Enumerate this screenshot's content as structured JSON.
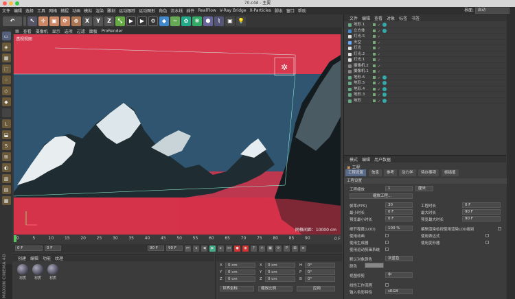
{
  "window": {
    "title": "70.c4d - 主要"
  },
  "menubar": {
    "items": [
      "文件",
      "编辑",
      "选择",
      "工具",
      "网格",
      "捕捉",
      "动画",
      "模拟",
      "渲染",
      "雕刻",
      "运动跟踪",
      "运动图形",
      "角色",
      "流水线",
      "插件",
      "RealFlow",
      "V-Ray Bridge",
      "X-Particles",
      "脚本",
      "窗口",
      "帮助"
    ],
    "layout_label": "界面:",
    "layout_value": "启动"
  },
  "toolbar": {
    "axis_x": "X",
    "axis_y": "Y",
    "axis_z": "Z"
  },
  "viewport": {
    "menu": [
      "查看",
      "摄像机",
      "显示",
      "选项",
      "过滤",
      "面板",
      "ProRender"
    ],
    "label": "透视视图",
    "grid_info": "网格间距：10000 cm"
  },
  "timeline": {
    "ticks": [
      "0",
      "5",
      "10",
      "15",
      "20",
      "25",
      "30",
      "35",
      "40",
      "45",
      "50",
      "55",
      "60",
      "65",
      "70",
      "75",
      "80",
      "85",
      "90"
    ],
    "end_label": "0 F",
    "current": "0 F",
    "start_field": "0 F",
    "end_field": "90 F",
    "end_field2": "90 F"
  },
  "materials": {
    "menu": [
      "创建",
      "编辑",
      "功能",
      "纹理"
    ],
    "items": [
      "材质",
      "材质",
      "材质"
    ]
  },
  "coords": {
    "rows": [
      {
        "a": "X",
        "av": "0 cm",
        "b": "X",
        "bv": "0 cm",
        "c": "H",
        "cv": "0°"
      },
      {
        "a": "Y",
        "av": "0 cm",
        "b": "Y",
        "bv": "0 cm",
        "c": "P",
        "cv": "0°"
      },
      {
        "a": "Z",
        "av": "0 cm",
        "b": "Z",
        "bv": "0 cm",
        "c": "B",
        "cv": "0°"
      }
    ],
    "world": "世界坐标",
    "scale": "缩放比例",
    "apply": "应用"
  },
  "objects": {
    "menu": [
      "文件",
      "编辑",
      "查看",
      "对象",
      "标签",
      "书签"
    ],
    "rows": [
      "地形.1",
      "立方体",
      "灯光.5",
      "天空",
      "灯光",
      "灯光.2",
      "灯光.1",
      "摄像机.2",
      "摄像机.1",
      "地形.6",
      "地形.5",
      "地形.4",
      "地形.3",
      "地形"
    ]
  },
  "attributes": {
    "menu": [
      "模式",
      "编辑",
      "用户数据"
    ],
    "title": "工程",
    "tabs": [
      "工程设置",
      "信息",
      "参考",
      "动力学",
      "待办事项",
      "帧插值"
    ],
    "section": "工程设置",
    "scale_label": "工程缩放",
    "scale_value": "1",
    "scale_unit": "厘米",
    "scale_button": "缩放工程...",
    "fps_label": "帧率(FPS)",
    "fps": "30",
    "duration_label": "工程时长",
    "duration": "0 F",
    "min_label": "最小时长",
    "min": "0 F",
    "max_label": "最大时长",
    "max": "90 F",
    "pmin_label": "预览最小时长",
    "pmin": "0 F",
    "pmax_label": "预览最大时长",
    "pmax": "90 F",
    "lod_label": "细节程度(LOD)",
    "lod": "100 %",
    "lod2_label": "编辑渲染检视使用渲染LOD级别",
    "anim_label": "使用动画",
    "expr_label": "使用表达式",
    "gen_label": "使用生成器",
    "deform_label": "使用变形器",
    "motion_label": "使用运动剪辑系统",
    "color_label": "默认对象颜色",
    "color_value": "灰蓝色",
    "color2_label": "颜色",
    "clip_label": "视图修剪",
    "clip_value": "中",
    "linear_label": "线性工作流程",
    "input_label": "输入色彩特性",
    "input_value": "sRGB"
  }
}
